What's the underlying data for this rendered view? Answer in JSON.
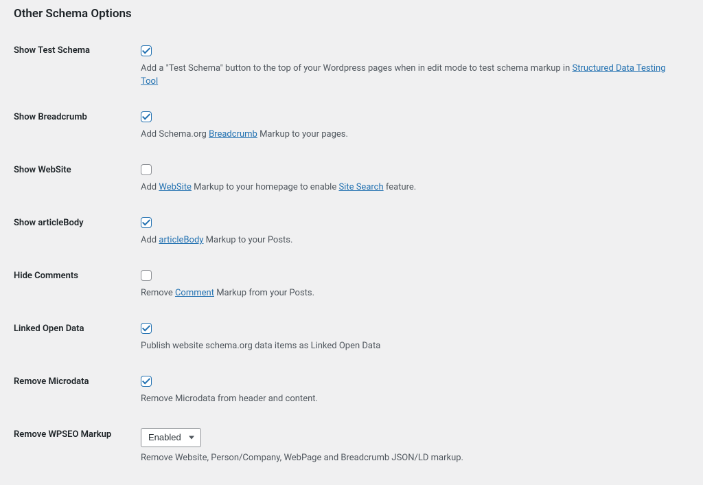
{
  "section_title": "Other Schema Options",
  "fields": {
    "show_test_schema": {
      "label": "Show Test Schema",
      "checked": true,
      "desc_before": "Add a \"Test Schema\" button to the top of your Wordpress pages when in edit mode to test schema markup in ",
      "link_text": "Structured Data Testing Tool",
      "desc_after": ""
    },
    "show_breadcrumb": {
      "label": "Show Breadcrumb",
      "checked": true,
      "desc_before": "Add Schema.org ",
      "link_text": "Breadcrumb",
      "desc_after": " Markup to your pages."
    },
    "show_website": {
      "label": "Show WebSite",
      "checked": false,
      "desc_before": "Add ",
      "link1_text": "WebSite",
      "desc_mid": " Markup to your homepage to enable ",
      "link2_text": "Site Search",
      "desc_after": " feature."
    },
    "show_articlebody": {
      "label": "Show articleBody",
      "checked": true,
      "desc_before": "Add ",
      "link_text": "articleBody",
      "desc_after": " Markup to your Posts."
    },
    "hide_comments": {
      "label": "Hide Comments",
      "checked": false,
      "desc_before": "Remove ",
      "link_text": "Comment",
      "desc_after": " Markup from your Posts."
    },
    "linked_open_data": {
      "label": "Linked Open Data",
      "checked": true,
      "desc": "Publish website schema.org data items as Linked Open Data"
    },
    "remove_microdata": {
      "label": "Remove Microdata",
      "checked": true,
      "desc": "Remove Microdata from header and content."
    },
    "remove_wpseo": {
      "label": "Remove WPSEO Markup",
      "selected": "Enabled",
      "desc": "Remove Website, Person/Company, WebPage and Breadcrumb JSON/LD markup."
    }
  }
}
